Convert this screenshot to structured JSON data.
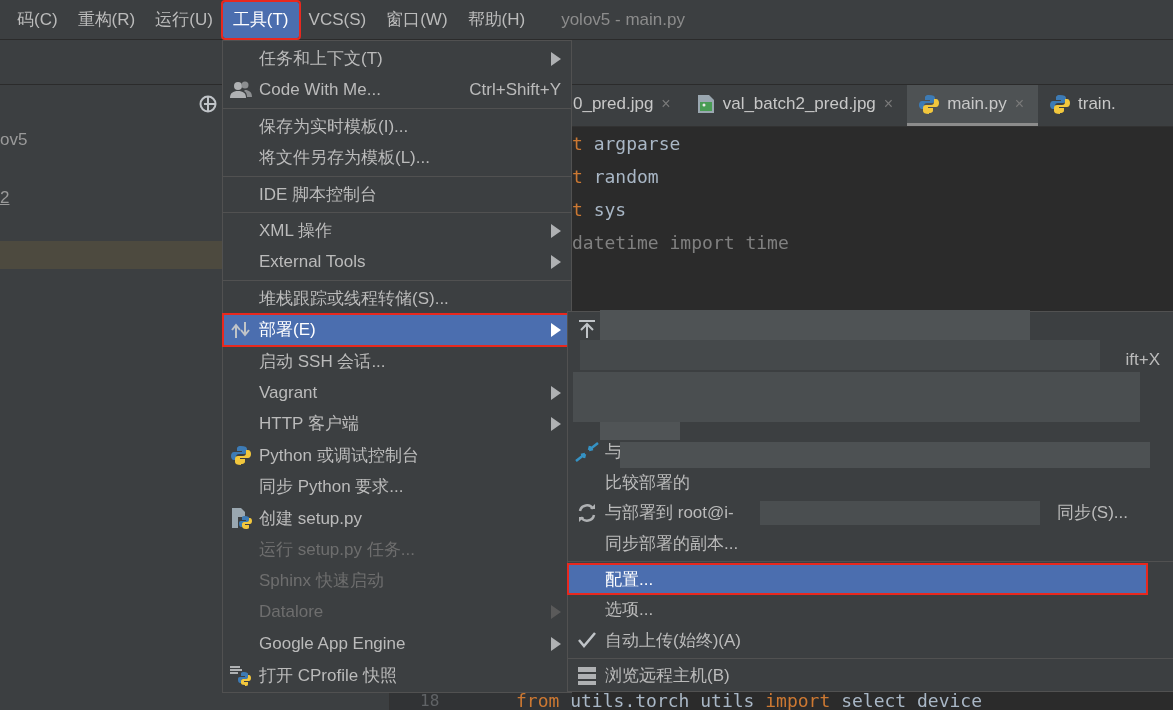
{
  "menubar": {
    "items": [
      {
        "label": "码(C)",
        "selected": false
      },
      {
        "label": "重构(R)",
        "selected": false
      },
      {
        "label": "运行(U)",
        "selected": false
      },
      {
        "label": "工具(T)",
        "selected": true
      },
      {
        "label": "VCS(S)",
        "selected": false
      },
      {
        "label": "窗口(W)",
        "selected": false
      },
      {
        "label": "帮助(H)",
        "selected": false
      }
    ],
    "title": "yolov5 - main.py"
  },
  "sidebar": {
    "rows": [
      {
        "label": "ov5",
        "selected": false
      },
      {
        "label": "2",
        "selected": false
      },
      {
        "selected": true
      }
    ]
  },
  "tabs": [
    {
      "label": "0_pred.jpg",
      "selected": false,
      "close": "×"
    },
    {
      "label": "val_batch2_pred.jpg",
      "selected": false,
      "close": "×"
    },
    {
      "label": "main.py",
      "selected": true,
      "close": "×"
    },
    {
      "label": "train.",
      "selected": false
    }
  ],
  "code_lines": [
    {
      "keyword": "t",
      "text": "argparse",
      "unused": false
    },
    {
      "keyword": "t",
      "text": "random",
      "unused": false
    },
    {
      "keyword": "t",
      "text": "sys",
      "unused": false
    },
    {
      "text": "datetime import time",
      "unused": true
    }
  ],
  "last_line": {
    "number": "18",
    "parts": [
      {
        "text": "from",
        "keyword": true
      },
      {
        "text": " utils.torch_utils ",
        "keyword": false
      },
      {
        "text": "import",
        "keyword": true
      },
      {
        "text": " select_device",
        "keyword": false
      }
    ]
  },
  "tools_menu": [
    {
      "kind": "item",
      "label": "任务和上下文(T)",
      "submenu": true,
      "disabled": false,
      "selected": false
    },
    {
      "kind": "item",
      "label": "Code With Me...",
      "shortcut": "Ctrl+Shift+Y",
      "submenu": false,
      "disabled": false,
      "selected": false
    },
    {
      "kind": "separator"
    },
    {
      "kind": "item",
      "label": "保存为实时模板(I)...",
      "submenu": false,
      "disabled": false,
      "selected": false
    },
    {
      "kind": "item",
      "label": "将文件另存为模板(L)...",
      "submenu": false,
      "disabled": false,
      "selected": false
    },
    {
      "kind": "separator"
    },
    {
      "kind": "item",
      "label": "IDE 脚本控制台",
      "submenu": false,
      "disabled": false,
      "selected": false
    },
    {
      "kind": "separator"
    },
    {
      "kind": "item",
      "label": "XML 操作",
      "submenu": true,
      "disabled": false,
      "selected": false
    },
    {
      "kind": "item",
      "label": "External Tools",
      "submenu": true,
      "disabled": false,
      "selected": false
    },
    {
      "kind": "separator"
    },
    {
      "kind": "item",
      "label": "堆栈跟踪或线程转储(S)...",
      "submenu": false,
      "disabled": false,
      "selected": false
    },
    {
      "kind": "item",
      "label": "部署(E)",
      "submenu": true,
      "disabled": false,
      "selected": true
    },
    {
      "kind": "item",
      "label": "启动 SSH 会话...",
      "submenu": false,
      "disabled": false,
      "selected": false
    },
    {
      "kind": "item",
      "label": "Vagrant",
      "submenu": true,
      "disabled": false,
      "selected": false
    },
    {
      "kind": "item",
      "label": "HTTP 客户端",
      "submenu": true,
      "disabled": false,
      "selected": false
    },
    {
      "kind": "item",
      "label": "Python 或调试控制台",
      "submenu": false,
      "disabled": false,
      "selected": false
    },
    {
      "kind": "item",
      "label": "同步 Python 要求...",
      "submenu": false,
      "disabled": false,
      "selected": false
    },
    {
      "kind": "item",
      "label": "创建 setup.py",
      "submenu": false,
      "disabled": false,
      "selected": false
    },
    {
      "kind": "item",
      "label": "运行 setup.py 任务...",
      "submenu": false,
      "disabled": true,
      "selected": false
    },
    {
      "kind": "item",
      "label": "Sphinx 快速启动",
      "submenu": false,
      "disabled": true,
      "selected": false
    },
    {
      "kind": "item",
      "label": "Datalore",
      "submenu": true,
      "disabled": true,
      "selected": false
    },
    {
      "kind": "item",
      "label": "Google App Engine",
      "submenu": true,
      "disabled": false,
      "selected": false
    },
    {
      "kind": "item",
      "label": "打开 CProfile 快照",
      "submenu": false,
      "disabled": false,
      "selected": false
    }
  ],
  "deploy_submenu": [
    {
      "kind": "item",
      "selected": false,
      "checked": false
    },
    {
      "kind": "item",
      "shortcut": "ift+X",
      "selected": false,
      "checked": false
    },
    {
      "kind": "item",
      "selected": false,
      "checked": false
    },
    {
      "kind": "item",
      "selected": false,
      "checked": false
    },
    {
      "kind": "item",
      "label": "与",
      "selected": false,
      "checked": false
    },
    {
      "kind": "item",
      "label": "比较部署的",
      "selected": false,
      "checked": false
    },
    {
      "kind": "item",
      "label": "与部署到 root@i-",
      "label_end": "同步(S)...",
      "selected": false,
      "checked": false
    },
    {
      "kind": "item",
      "label": "同步部署的副本...",
      "selected": false,
      "checked": false
    },
    {
      "kind": "separator"
    },
    {
      "kind": "item",
      "label": "配置...",
      "selected": true,
      "checked": false
    },
    {
      "kind": "item",
      "label": "选项...",
      "selected": false,
      "checked": false
    },
    {
      "kind": "item",
      "label": "自动上传(始终)(A)",
      "selected": false,
      "checked": true
    },
    {
      "kind": "separator"
    },
    {
      "kind": "item",
      "label": "浏览远程主机(B)",
      "selected": false,
      "checked": false
    }
  ]
}
